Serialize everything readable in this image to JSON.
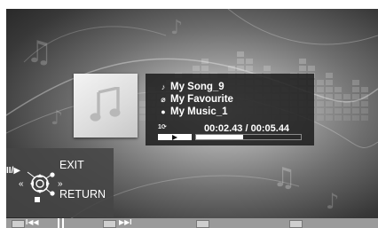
{
  "track": {
    "song": "My Song_9",
    "favourite": "My Favourite",
    "music": "My Music_1",
    "repeat_label": "1",
    "elapsed": "00:02.43",
    "separator": "/",
    "total": "00:05.44",
    "progress_fraction": 0.45
  },
  "controls": {
    "exit_label": "EXIT",
    "return_label": "RETURN",
    "play_pause_glyph": "II/▶",
    "rewind_glyph": "«",
    "forward_glyph": "»"
  },
  "bottom": {
    "skip_back_glyph": "I◀◀",
    "skip_fwd_glyph": "▶▶I"
  },
  "icons": {
    "song": "music-note-icon",
    "favourite": "tag-icon",
    "music": "person-icon",
    "repeat": "repeat-one-icon"
  },
  "colors": {
    "panel": "#1c1c1c",
    "text": "#ffffff"
  }
}
